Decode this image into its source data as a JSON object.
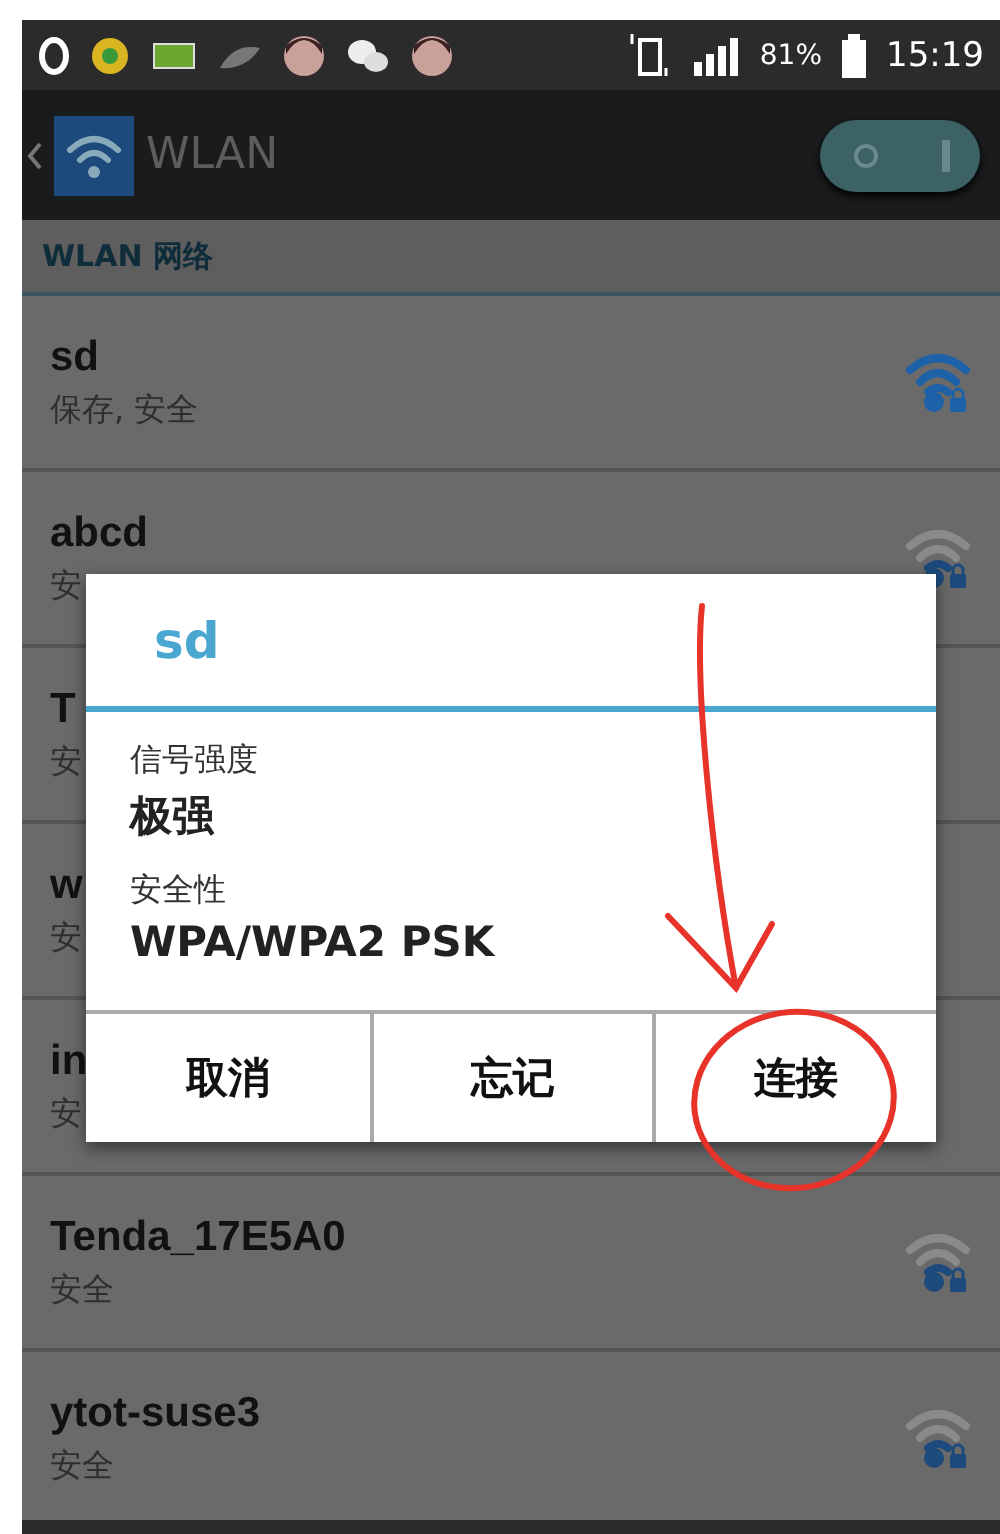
{
  "status_bar": {
    "battery_percent": "81%",
    "time": "15:19"
  },
  "action_bar": {
    "title": "WLAN",
    "switch": {
      "on": true
    }
  },
  "section_header": "WLAN 网络",
  "networks": [
    {
      "name": "sd",
      "status": "保存, 安全",
      "saved": true
    },
    {
      "name": "abcd",
      "status": "安",
      "saved": false
    },
    {
      "name": "T",
      "status": "安"
    },
    {
      "name": "w",
      "status": "安"
    },
    {
      "name": "in",
      "status": "安"
    },
    {
      "name": "Tenda_17E5A0",
      "status": "安全",
      "saved": false
    },
    {
      "name": "ytot-suse3",
      "status": "安全",
      "saved": false
    }
  ],
  "dialog": {
    "title": "sd",
    "fields": [
      {
        "label": "信号强度",
        "value": "极强"
      },
      {
        "label": "安全性",
        "value": "WPA/WPA2 PSK"
      }
    ],
    "buttons": [
      "取消",
      "忘记",
      "连接"
    ]
  }
}
